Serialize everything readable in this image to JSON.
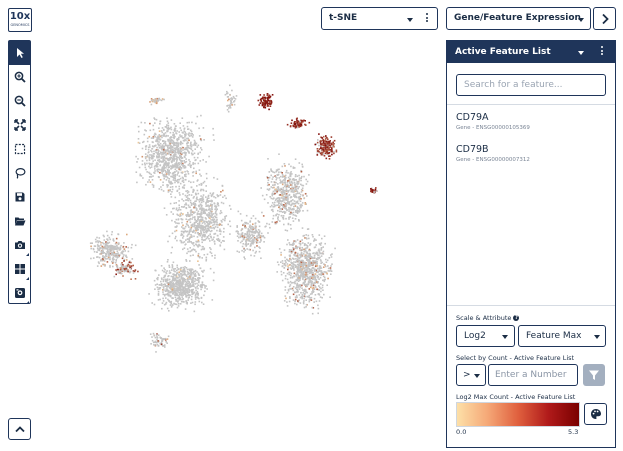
{
  "logo": {
    "big": "10x",
    "small": "GENOMICS"
  },
  "toolbar": {
    "tools": [
      {
        "name": "select-arrow-icon",
        "active": true
      },
      {
        "name": "zoom-in-icon"
      },
      {
        "name": "zoom-out-icon"
      },
      {
        "name": "fit-screen-icon"
      },
      {
        "name": "rectangle-select-icon"
      },
      {
        "name": "lasso-icon"
      },
      {
        "name": "save-icon"
      },
      {
        "name": "folder-open-icon"
      },
      {
        "name": "camera-icon"
      },
      {
        "name": "grid-layout-icon"
      },
      {
        "name": "export-image-icon"
      }
    ]
  },
  "projection": {
    "label": "t-SNE"
  },
  "category": {
    "label": "Gene/Feature Expression"
  },
  "panel": {
    "title": "Active Feature List",
    "search_placeholder": "Search for a feature...",
    "features": [
      {
        "name": "CD79A",
        "sub": "Gene - ENSG00000105369"
      },
      {
        "name": "CD79B",
        "sub": "Gene - ENSG00000007312"
      }
    ],
    "scale_label": "Scale & Attribute",
    "scale_value": "Log2",
    "attribute_value": "Feature Max",
    "select_by_label": "Select by Count - Active Feature List",
    "operator_value": ">",
    "number_placeholder": "Enter a Number",
    "legend_label": "Log2 Max Count - Active Feature List",
    "legend_min": "0.0",
    "legend_max": "5.3",
    "colors": {
      "low": "#fde0a8",
      "high": "#7a0000",
      "grey": "#c4c4c4",
      "navy": "#1f355a"
    }
  }
}
